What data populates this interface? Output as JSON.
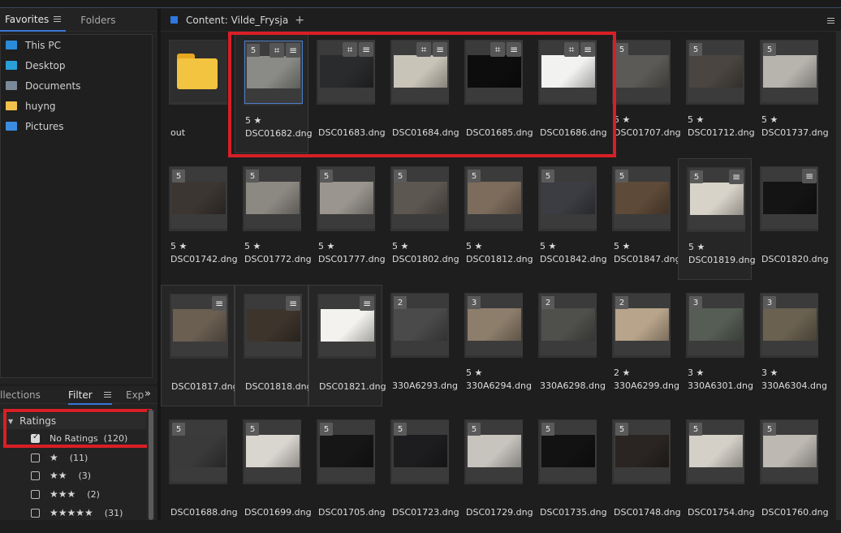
{
  "left_panel": {
    "tabs": [
      "Favorites",
      "Folders"
    ],
    "favorites": [
      {
        "label": "This PC",
        "icon": "computer-icon"
      },
      {
        "label": "Desktop",
        "icon": "desktop-icon"
      },
      {
        "label": "Documents",
        "icon": "documents-icon"
      },
      {
        "label": "huyng",
        "icon": "folder-icon"
      },
      {
        "label": "Pictures",
        "icon": "pictures-icon"
      }
    ]
  },
  "bottom_panel": {
    "tabs": [
      "llections",
      "Filter",
      "Expo"
    ],
    "arrows": "»",
    "ratings_header": "Ratings",
    "filters": [
      {
        "stars": "",
        "label": "No Ratings",
        "count": "(120)",
        "checked": true
      },
      {
        "stars": "★",
        "label": "",
        "count": "(11)",
        "checked": false
      },
      {
        "stars": "★★",
        "label": "",
        "count": "(3)",
        "checked": false
      },
      {
        "stars": "★★★",
        "label": "",
        "count": "(2)",
        "checked": false
      },
      {
        "stars": "★★★★★",
        "label": "",
        "count": "(31)",
        "checked": false
      }
    ]
  },
  "content": {
    "title": "Content: Vilde_Frysja",
    "plus": "+"
  },
  "files": [
    {
      "name": "out",
      "type": "folder",
      "badge": "",
      "rating": "",
      "crop": false,
      "adj": false,
      "tone": "#000"
    },
    {
      "name": "DSC01682.dng",
      "badge": "5",
      "rating": "5 ★",
      "crop": true,
      "adj": true,
      "tone": "#8a8a86",
      "selected": true
    },
    {
      "name": "DSC01683.dng",
      "badge": "",
      "rating": "",
      "crop": true,
      "adj": true,
      "tone": "#2a2b2c"
    },
    {
      "name": "DSC01684.dng",
      "badge": "",
      "rating": "",
      "crop": true,
      "adj": true,
      "tone": "#c9c4b8"
    },
    {
      "name": "DSC01685.dng",
      "badge": "",
      "rating": "",
      "crop": true,
      "adj": true,
      "tone": "#0d0d0d"
    },
    {
      "name": "DSC01686.dng",
      "badge": "",
      "rating": "",
      "crop": true,
      "adj": true,
      "tone": "#f2f2f0"
    },
    {
      "name": "DSC01707.dng",
      "badge": "5",
      "rating": "5 ★",
      "crop": false,
      "adj": false,
      "tone": "#5c5a56"
    },
    {
      "name": "DSC01712.dng",
      "badge": "5",
      "rating": "5 ★",
      "crop": false,
      "adj": false,
      "tone": "#4a4540"
    },
    {
      "name": "DSC01737.dng",
      "badge": "5",
      "rating": "5 ★",
      "crop": false,
      "adj": false,
      "tone": "#b7b4ad"
    },
    {
      "name": "DSC01742.dng",
      "badge": "5",
      "rating": "5 ★",
      "crop": false,
      "adj": false,
      "tone": "#3c3632"
    },
    {
      "name": "DSC01772.dng",
      "badge": "5",
      "rating": "5 ★",
      "crop": false,
      "adj": false,
      "tone": "#8c8882"
    },
    {
      "name": "DSC01777.dng",
      "badge": "5",
      "rating": "5 ★",
      "crop": false,
      "adj": false,
      "tone": "#9a968f"
    },
    {
      "name": "DSC01802.dng",
      "badge": "5",
      "rating": "5 ★",
      "crop": false,
      "adj": false,
      "tone": "#5d5751"
    },
    {
      "name": "DSC01812.dng",
      "badge": "5",
      "rating": "5 ★",
      "crop": false,
      "adj": false,
      "tone": "#7d6c5c"
    },
    {
      "name": "DSC01842.dng",
      "badge": "5",
      "rating": "5 ★",
      "crop": false,
      "adj": false,
      "tone": "#3b3d42"
    },
    {
      "name": "DSC01847.dng",
      "badge": "5",
      "rating": "5 ★",
      "crop": false,
      "adj": false,
      "tone": "#5e4a38"
    },
    {
      "name": "DSC01819.dng",
      "badge": "5",
      "rating": "5 ★",
      "crop": false,
      "adj": true,
      "tone": "#d8d3c9",
      "selected": true
    },
    {
      "name": "DSC01820.dng",
      "badge": "",
      "rating": "",
      "crop": false,
      "adj": true,
      "tone": "#141414"
    },
    {
      "name": "DSC01817.dng",
      "badge": "",
      "rating": "",
      "crop": false,
      "adj": true,
      "tone": "#6b5f52",
      "selected": true
    },
    {
      "name": "DSC01818.dng",
      "badge": "",
      "rating": "",
      "crop": false,
      "adj": true,
      "tone": "#3d342c",
      "selected": true
    },
    {
      "name": "DSC01821.dng",
      "badge": "",
      "rating": "",
      "crop": false,
      "adj": true,
      "tone": "#f4f2ee",
      "selected": true
    },
    {
      "name": "330A6293.dng",
      "badge": "2",
      "rating": "",
      "crop": false,
      "adj": false,
      "tone": "#4a4a4a"
    },
    {
      "name": "330A6294.dng",
      "badge": "3",
      "rating": "5 ★",
      "crop": false,
      "adj": false,
      "tone": "#8d7e6c"
    },
    {
      "name": "330A6298.dng",
      "badge": "2",
      "rating": "",
      "crop": false,
      "adj": false,
      "tone": "#4f504c"
    },
    {
      "name": "330A6299.dng",
      "badge": "2",
      "rating": "2 ★",
      "crop": false,
      "adj": false,
      "tone": "#b8a48a"
    },
    {
      "name": "330A6301.dng",
      "badge": "3",
      "rating": "3 ★",
      "crop": false,
      "adj": false,
      "tone": "#565d55"
    },
    {
      "name": "330A6304.dng",
      "badge": "3",
      "rating": "3 ★",
      "crop": false,
      "adj": false,
      "tone": "#6a6150"
    },
    {
      "name": "DSC01688.dng",
      "badge": "5",
      "rating": "",
      "crop": false,
      "adj": false,
      "tone": "#3a3a3a"
    },
    {
      "name": "DSC01699.dng",
      "badge": "5",
      "rating": "",
      "crop": false,
      "adj": false,
      "tone": "#d9d5cf"
    },
    {
      "name": "DSC01705.dng",
      "badge": "5",
      "rating": "",
      "crop": false,
      "adj": false,
      "tone": "#161616"
    },
    {
      "name": "DSC01723.dng",
      "badge": "5",
      "rating": "",
      "crop": false,
      "adj": false,
      "tone": "#1d1d1f"
    },
    {
      "name": "DSC01729.dng",
      "badge": "5",
      "rating": "",
      "crop": false,
      "adj": false,
      "tone": "#c7c4be"
    },
    {
      "name": "DSC01735.dng",
      "badge": "5",
      "rating": "",
      "crop": false,
      "adj": false,
      "tone": "#121212"
    },
    {
      "name": "DSC01748.dng",
      "badge": "5",
      "rating": "",
      "crop": false,
      "adj": false,
      "tone": "#2a2522"
    },
    {
      "name": "DSC01754.dng",
      "badge": "5",
      "rating": "",
      "crop": false,
      "adj": false,
      "tone": "#d4d0c8"
    },
    {
      "name": "DSC01760.dng",
      "badge": "5",
      "rating": "",
      "crop": false,
      "adj": false,
      "tone": "#bdb9b2"
    }
  ],
  "colors": {
    "accent": "#3a76d6",
    "highlight_red": "#d81f26",
    "panel_bg": "#232323"
  }
}
